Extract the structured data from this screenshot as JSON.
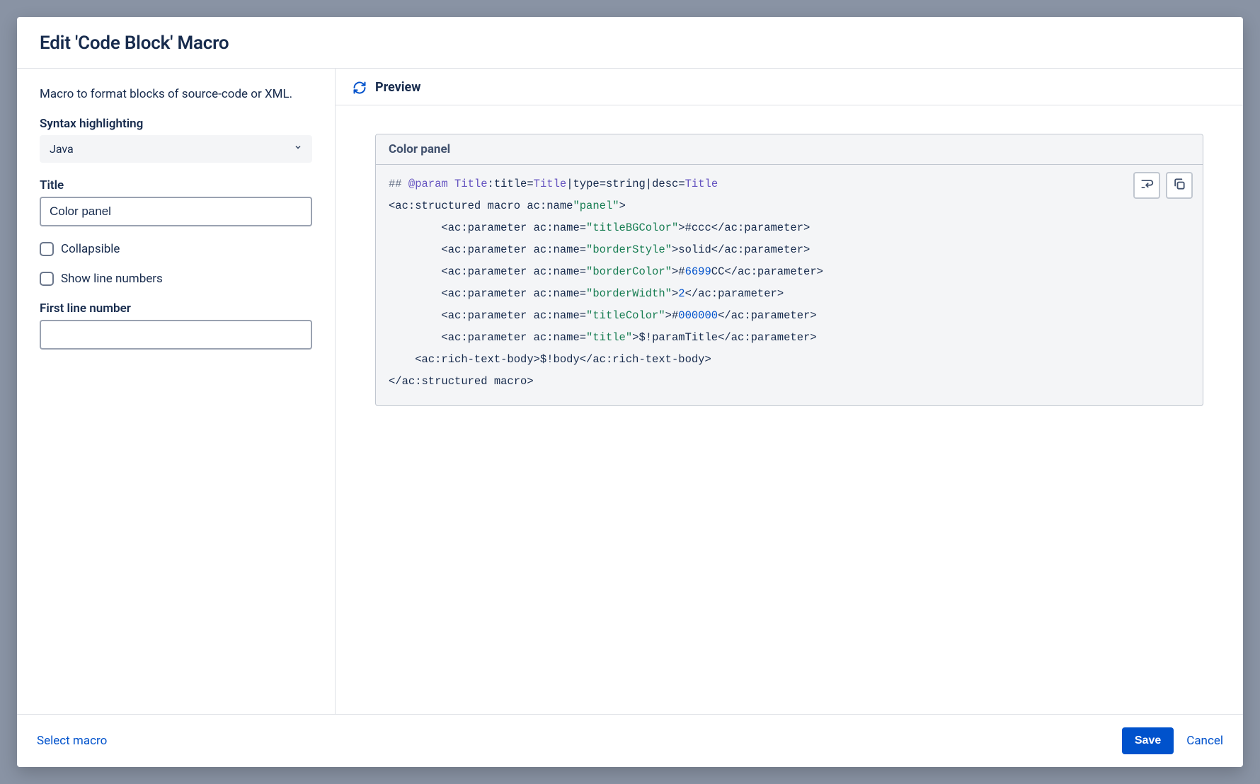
{
  "dialog": {
    "title": "Edit 'Code Block' Macro",
    "description": "Macro to format blocks of source-code or XML."
  },
  "form": {
    "syntax_label": "Syntax highlighting",
    "syntax_value": "Java",
    "title_label": "Title",
    "title_value": "Color panel",
    "collapsible_label": "Collapsible",
    "collapsible_checked": false,
    "show_line_numbers_label": "Show line numbers",
    "show_line_numbers_checked": false,
    "first_line_label": "First line number",
    "first_line_value": ""
  },
  "preview": {
    "header_label": "Preview",
    "code_title": "Color panel",
    "code_segments": [
      {
        "t": "## ",
        "c": "comment"
      },
      {
        "t": "@param",
        "c": "annot"
      },
      {
        "t": " ",
        "c": ""
      },
      {
        "t": "Title",
        "c": "keyword"
      },
      {
        "t": ":title=",
        "c": ""
      },
      {
        "t": "Title",
        "c": "keyword"
      },
      {
        "t": "|type=string|desc=",
        "c": ""
      },
      {
        "t": "Title",
        "c": "keyword"
      },
      {
        "t": "\n",
        "c": ""
      },
      {
        "t": "<ac:structured macro ac:name",
        "c": "tag"
      },
      {
        "t": "\"panel\"",
        "c": "string"
      },
      {
        "t": ">\n",
        "c": "tag"
      },
      {
        "t": "        <ac:parameter ac:name=",
        "c": "tag"
      },
      {
        "t": "\"titleBGColor\"",
        "c": "string"
      },
      {
        "t": ">#ccc</ac:parameter>\n",
        "c": "tag"
      },
      {
        "t": "        <ac:parameter ac:name=",
        "c": "tag"
      },
      {
        "t": "\"borderStyle\"",
        "c": "string"
      },
      {
        "t": ">solid</ac:parameter>\n",
        "c": "tag"
      },
      {
        "t": "        <ac:parameter ac:name=",
        "c": "tag"
      },
      {
        "t": "\"borderColor\"",
        "c": "string"
      },
      {
        "t": ">#",
        "c": "tag"
      },
      {
        "t": "6699",
        "c": "num"
      },
      {
        "t": "CC</ac:parameter>\n",
        "c": "tag"
      },
      {
        "t": "        <ac:parameter ac:name=",
        "c": "tag"
      },
      {
        "t": "\"borderWidth\"",
        "c": "string"
      },
      {
        "t": ">",
        "c": "tag"
      },
      {
        "t": "2",
        "c": "num"
      },
      {
        "t": "</ac:parameter>\n",
        "c": "tag"
      },
      {
        "t": "        <ac:parameter ac:name=",
        "c": "tag"
      },
      {
        "t": "\"titleColor\"",
        "c": "string"
      },
      {
        "t": ">#",
        "c": "tag"
      },
      {
        "t": "000000",
        "c": "num"
      },
      {
        "t": "</ac:parameter>\n",
        "c": "tag"
      },
      {
        "t": "        <ac:parameter ac:name=",
        "c": "tag"
      },
      {
        "t": "\"title\"",
        "c": "string"
      },
      {
        "t": ">$!paramTitle</ac:parameter>\n",
        "c": "tag"
      },
      {
        "t": "    <ac:rich-text-body>$!body</ac:rich-text-body>\n",
        "c": "tag"
      },
      {
        "t": "</ac:structured macro>",
        "c": "tag"
      }
    ]
  },
  "footer": {
    "select_macro": "Select macro",
    "save": "Save",
    "cancel": "Cancel"
  }
}
